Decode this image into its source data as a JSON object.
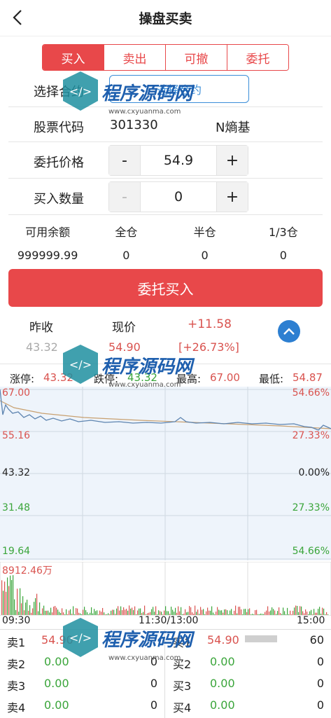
{
  "header": {
    "title": "操盘买卖"
  },
  "tabs": [
    "买入",
    "卖出",
    "可撤",
    "委托"
  ],
  "form": {
    "select_label": "选择合约",
    "select_button": "选择合约",
    "code_label": "股票代码",
    "code_value": "301330",
    "stock_name": "N熵基",
    "price_label": "委托价格",
    "price_value": "54.9",
    "qty_label": "买入数量",
    "qty_value": "0",
    "minus": "-",
    "plus": "+"
  },
  "balance": {
    "headers": [
      "可用余额",
      "全仓",
      "半仓",
      "1/3仓"
    ],
    "values": [
      "999999.99",
      "0",
      "0",
      "0"
    ]
  },
  "submit_label": "委托买入",
  "quote": {
    "prev_close_label": "昨收",
    "prev_close": "43.32",
    "current_label": "现价",
    "current": "54.90",
    "change": "+11.58",
    "change_pct": "[+26.73%]"
  },
  "limits": {
    "up_label": "涨停:",
    "up": "43.32",
    "down_label": "跌停:",
    "down": "43.32",
    "high_label": "最高:",
    "high": "67.00",
    "low_label": "最低:",
    "low": "54.87"
  },
  "chart": {
    "left_labels": [
      "67.00",
      "55.16",
      "43.32",
      "31.48",
      "19.64"
    ],
    "right_labels": [
      "54.66%",
      "27.33%",
      "0.00%",
      "27.33%",
      "54.66%"
    ],
    "volume_label": "8912.46万",
    "time_start": "09:30",
    "time_mid": "11:30/13:00",
    "time_end": "15:00"
  },
  "order_book": {
    "sell": [
      {
        "label": "卖1",
        "price": "54.90",
        "qty": ""
      },
      {
        "label": "卖2",
        "price": "0.00",
        "qty": "0"
      },
      {
        "label": "卖3",
        "price": "0.00",
        "qty": "0"
      },
      {
        "label": "卖4",
        "price": "0.00",
        "qty": "0"
      }
    ],
    "buy": [
      {
        "label": "买1",
        "price": "54.90",
        "qty": "60"
      },
      {
        "label": "买2",
        "price": "0.00",
        "qty": "0"
      },
      {
        "label": "买3",
        "price": "0.00",
        "qty": "0"
      },
      {
        "label": "买4",
        "price": "0.00",
        "qty": "0"
      }
    ]
  },
  "watermark": {
    "brand": "程序源码网",
    "url": "www.cxyuanma.com"
  },
  "colors": {
    "accent_red": "#e8484a",
    "blue": "#3a8dd8",
    "up": "#d9534f",
    "down": "#3aa53a"
  }
}
